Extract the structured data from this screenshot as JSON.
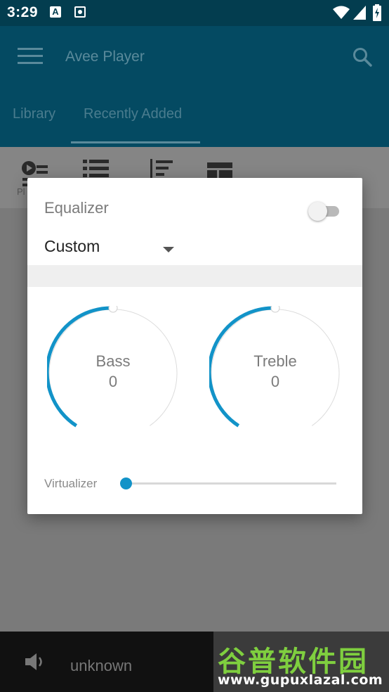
{
  "status_bar": {
    "time": "3:29",
    "icons": [
      "a-badge-icon",
      "screen-record-icon",
      "wifi-icon",
      "signal-icon",
      "battery-charging-icon"
    ]
  },
  "app_bar": {
    "title": "Avee Player",
    "menu_icon": "hamburger-icon",
    "search_icon": "search-icon"
  },
  "tabs": [
    {
      "label": "Library"
    },
    {
      "label": "Recently Added"
    }
  ],
  "toolbar": {
    "playlist_label": "Pl"
  },
  "dialog": {
    "title": "Equalizer",
    "enabled": false,
    "preset": "Custom",
    "knobs": [
      {
        "label": "Bass",
        "value": "0",
        "level": 0
      },
      {
        "label": "Treble",
        "value": "0",
        "level": 0
      }
    ],
    "virtualizer": {
      "label": "Virtualizer",
      "level": 0
    }
  },
  "now_playing": {
    "track": "unknown"
  },
  "watermark": {
    "title": "谷普软件园",
    "url": "www.gupuxlazal.com"
  },
  "colors": {
    "accent": "#1293c8",
    "app_bar": "#044a62",
    "status_bar": "#033d4f"
  }
}
